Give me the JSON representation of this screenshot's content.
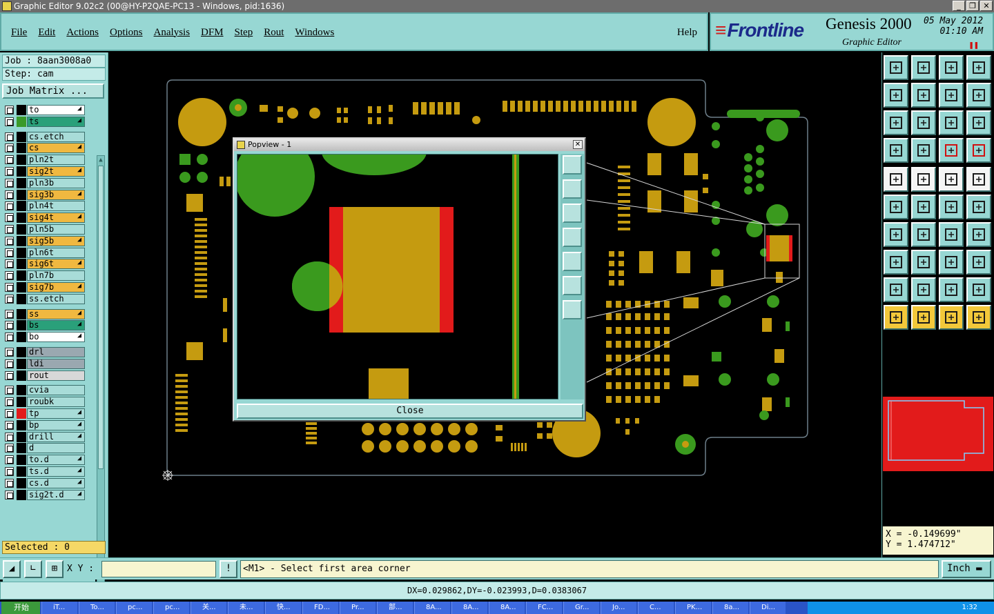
{
  "window": {
    "title": "Graphic Editor 9.02c2 (00@HY-P2QAE-PC13 - Windows, pid:1636)",
    "controls": [
      "_",
      "❐",
      "✕"
    ]
  },
  "menu": {
    "items": [
      "File",
      "Edit",
      "Actions",
      "Options",
      "Analysis",
      "DFM",
      "Step",
      "Rout",
      "Windows"
    ],
    "help": "Help"
  },
  "brand": {
    "logo": "Frontline",
    "product": "Genesis 2000",
    "subtitle": "Graphic Editor",
    "date": "05 May 2012",
    "time": "01:10 AM"
  },
  "job": {
    "job_line": "Job : 8aan3008a0",
    "step_line": "Step: cam",
    "matrix_button": "Job Matrix ..."
  },
  "layers": [
    {
      "name": "to",
      "swatch": "#000000",
      "bg": "#ffffff",
      "arrow": true
    },
    {
      "name": "ts",
      "swatch": "#3a9a2a",
      "bg": "#2aa07a",
      "arrow": true
    },
    {
      "name": "cs.etch",
      "swatch": "#000000",
      "bg": "#a8dcd8",
      "arrow": false
    },
    {
      "name": "cs",
      "swatch": "#000000",
      "bg": "#f0b840",
      "arrow": true
    },
    {
      "name": "pln2t",
      "swatch": "#000000",
      "bg": "#a8dcd8",
      "arrow": false
    },
    {
      "name": "sig2t",
      "swatch": "#000000",
      "bg": "#f0b840",
      "arrow": true
    },
    {
      "name": "pln3b",
      "swatch": "#000000",
      "bg": "#a8dcd8",
      "arrow": false
    },
    {
      "name": "sig3b",
      "swatch": "#000000",
      "bg": "#f0b840",
      "arrow": true
    },
    {
      "name": "pln4t",
      "swatch": "#000000",
      "bg": "#a8dcd8",
      "arrow": false
    },
    {
      "name": "sig4t",
      "swatch": "#000000",
      "bg": "#f0b840",
      "arrow": true
    },
    {
      "name": "pln5b",
      "swatch": "#000000",
      "bg": "#a8dcd8",
      "arrow": false
    },
    {
      "name": "sig5b",
      "swatch": "#000000",
      "bg": "#f0b840",
      "arrow": true
    },
    {
      "name": "pln6t",
      "swatch": "#000000",
      "bg": "#a8dcd8",
      "arrow": false
    },
    {
      "name": "sig6t",
      "swatch": "#000000",
      "bg": "#f0b840",
      "arrow": true
    },
    {
      "name": "pln7b",
      "swatch": "#000000",
      "bg": "#a8dcd8",
      "arrow": false
    },
    {
      "name": "sig7b",
      "swatch": "#000000",
      "bg": "#f0b840",
      "arrow": true
    },
    {
      "name": "ss.etch",
      "swatch": "#000000",
      "bg": "#a8dcd8",
      "arrow": false
    },
    {
      "name": "ss",
      "swatch": "#000000",
      "bg": "#f0b840",
      "arrow": true
    },
    {
      "name": "bs",
      "swatch": "#000000",
      "bg": "#2aa07a",
      "arrow": true
    },
    {
      "name": "bo",
      "swatch": "#000000",
      "bg": "#ffffff",
      "arrow": true
    },
    {
      "name": "drl",
      "swatch": "#000000",
      "bg": "#9aa8b0",
      "arrow": false
    },
    {
      "name": "ldi",
      "swatch": "#000000",
      "bg": "#9aa8b0",
      "arrow": false
    },
    {
      "name": "rout",
      "swatch": "#000000",
      "bg": "#d8d8d8",
      "arrow": false
    },
    {
      "name": "cvia",
      "swatch": "#000000",
      "bg": "#a8dcd8",
      "arrow": false
    },
    {
      "name": "roubk",
      "swatch": "#000000",
      "bg": "#a8dcd8",
      "arrow": false
    },
    {
      "name": "tp",
      "swatch": "#e21b1b",
      "bg": "#a8dcd8",
      "arrow": true
    },
    {
      "name": "bp",
      "swatch": "#000000",
      "bg": "#a8dcd8",
      "arrow": true
    },
    {
      "name": "drill",
      "swatch": "#000000",
      "bg": "#a8dcd8",
      "arrow": true
    },
    {
      "name": "d",
      "swatch": "#000000",
      "bg": "#a8dcd8",
      "arrow": false
    },
    {
      "name": "to.d",
      "swatch": "#000000",
      "bg": "#a8dcd8",
      "arrow": true
    },
    {
      "name": "ts.d",
      "swatch": "#000000",
      "bg": "#a8dcd8",
      "arrow": true
    },
    {
      "name": "cs.d",
      "swatch": "#000000",
      "bg": "#a8dcd8",
      "arrow": true
    },
    {
      "name": "sig2t.d",
      "swatch": "#000000",
      "bg": "#a8dcd8",
      "arrow": true
    }
  ],
  "selected": "Selected : 0",
  "popview": {
    "title": "Popview - 1",
    "close_label": "Close"
  },
  "coords": {
    "x": "X = -0.149699\"",
    "y": "Y = 1.474712\""
  },
  "command": {
    "xy_label": "X Y :",
    "xy_value": "",
    "prompt": "<M1> - Select first area corner",
    "unit": "Inch"
  },
  "status": "DX=0.029862,DY=-0.023993,D=0.0383067",
  "taskbar": {
    "start": "开始",
    "tasks": [
      "iT...",
      "To...",
      "pc...",
      "pc...",
      "关...",
      "未...",
      "快...",
      "FD...",
      "Pr...",
      "部...",
      "8A...",
      "8A...",
      "8A...",
      "FC...",
      "Gr...",
      "Jo...",
      "C...",
      "PK...",
      "8a...",
      "Di..."
    ],
    "clock": "1:32"
  },
  "colors": {
    "panel": "#97d7d3",
    "copper": "#c59b10",
    "mask": "#3a9a1e",
    "highlight": "#e21b1b"
  }
}
